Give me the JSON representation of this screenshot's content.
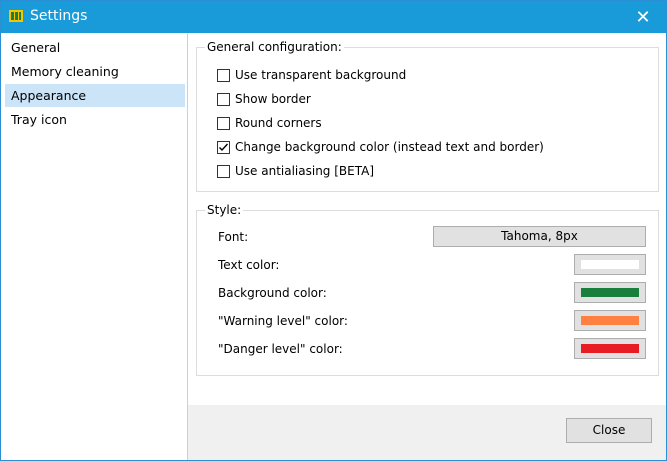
{
  "window": {
    "title": "Settings",
    "close_glyph": "✕"
  },
  "sidebar": {
    "items": [
      {
        "label": "General",
        "selected": false
      },
      {
        "label": "Memory cleaning",
        "selected": false
      },
      {
        "label": "Appearance",
        "selected": true
      },
      {
        "label": "Tray icon",
        "selected": false
      }
    ]
  },
  "general_config": {
    "title": "General configuration:",
    "options": [
      {
        "label": "Use transparent background",
        "checked": false
      },
      {
        "label": "Show border",
        "checked": false
      },
      {
        "label": "Round corners",
        "checked": false
      },
      {
        "label": "Change background color (instead text and border)",
        "checked": true
      },
      {
        "label": "Use antialiasing [BETA]",
        "checked": false
      }
    ]
  },
  "style": {
    "title": "Style:",
    "font_label": "Font:",
    "font_value": "Tahoma, 8px",
    "colors": [
      {
        "label": "Text color:",
        "color": "#ffffff"
      },
      {
        "label": "Background color:",
        "color": "#1a7f3c"
      },
      {
        "label": "\"Warning level\" color:",
        "color": "#ff8040"
      },
      {
        "label": "\"Danger level\" color:",
        "color": "#e81c24"
      }
    ]
  },
  "footer": {
    "close_label": "Close"
  },
  "colors": {
    "titlebar": "#1a9bd9",
    "selection": "#cce4f7"
  }
}
